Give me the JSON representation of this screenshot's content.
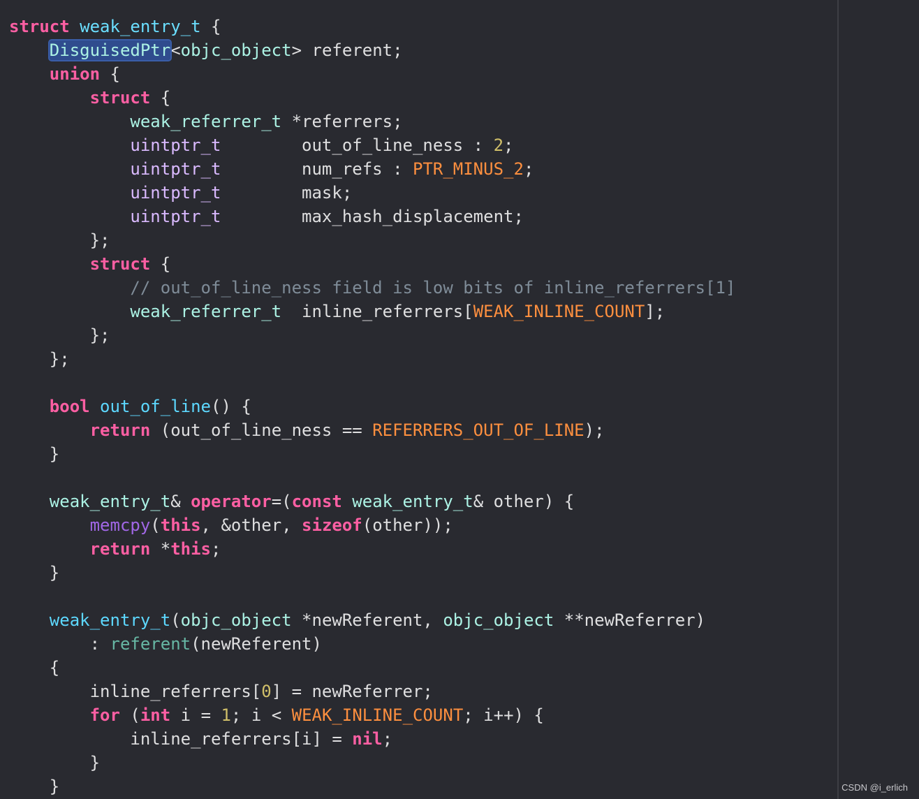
{
  "editor": {
    "theme_colors": {
      "background": "#292a30",
      "keyword": "#fc5fa3",
      "type": "#dabaff",
      "project_type": "#acf2e4",
      "declaration": "#6bdfff",
      "number": "#d0bf69",
      "macro": "#fd8f3f",
      "function": "#a167e6",
      "comment": "#7f8c98",
      "plain": "#dfdfe0",
      "selection": "#2f4c8e"
    },
    "lines": [
      [
        [
          "kw",
          "struct"
        ],
        [
          "pl",
          " "
        ],
        [
          "decl",
          "weak_entry_t"
        ],
        [
          "pl",
          " {"
        ]
      ],
      [
        [
          "pl",
          "    "
        ],
        [
          "ptype sel",
          "DisguisedPtr"
        ],
        [
          "pl",
          "<"
        ],
        [
          "ptype",
          "objc_object"
        ],
        [
          "pl",
          "> referent;"
        ]
      ],
      [
        [
          "pl",
          "    "
        ],
        [
          "kw",
          "union"
        ],
        [
          "pl",
          " {"
        ]
      ],
      [
        [
          "pl",
          "        "
        ],
        [
          "kw",
          "struct"
        ],
        [
          "pl",
          " {"
        ]
      ],
      [
        [
          "pl",
          "            "
        ],
        [
          "ptype",
          "weak_referrer_t"
        ],
        [
          "pl",
          " *referrers;"
        ]
      ],
      [
        [
          "pl",
          "            "
        ],
        [
          "type",
          "uintptr_t"
        ],
        [
          "pl",
          "        out_of_line_ness : "
        ],
        [
          "num",
          "2"
        ],
        [
          "pl",
          ";"
        ]
      ],
      [
        [
          "pl",
          "            "
        ],
        [
          "type",
          "uintptr_t"
        ],
        [
          "pl",
          "        num_refs : "
        ],
        [
          "macro",
          "PTR_MINUS_2"
        ],
        [
          "pl",
          ";"
        ]
      ],
      [
        [
          "pl",
          "            "
        ],
        [
          "type",
          "uintptr_t"
        ],
        [
          "pl",
          "        mask;"
        ]
      ],
      [
        [
          "pl",
          "            "
        ],
        [
          "type",
          "uintptr_t"
        ],
        [
          "pl",
          "        max_hash_displacement;"
        ]
      ],
      [
        [
          "pl",
          "        };"
        ]
      ],
      [
        [
          "pl",
          "        "
        ],
        [
          "kw",
          "struct"
        ],
        [
          "pl",
          " {"
        ]
      ],
      [
        [
          "pl",
          "            "
        ],
        [
          "cm",
          "// out_of_line_ness field is low bits of inline_referrers[1]"
        ]
      ],
      [
        [
          "pl",
          "            "
        ],
        [
          "ptype",
          "weak_referrer_t"
        ],
        [
          "pl",
          "  inline_referrers["
        ],
        [
          "macro",
          "WEAK_INLINE_COUNT"
        ],
        [
          "pl",
          "];"
        ]
      ],
      [
        [
          "pl",
          "        };"
        ]
      ],
      [
        [
          "pl",
          "    };"
        ]
      ],
      [
        [
          "pl",
          ""
        ]
      ],
      [
        [
          "pl",
          "    "
        ],
        [
          "kw",
          "bool"
        ],
        [
          "pl",
          " "
        ],
        [
          "decl2",
          "out_of_line"
        ],
        [
          "pl",
          "() {"
        ]
      ],
      [
        [
          "pl",
          "        "
        ],
        [
          "kw",
          "return"
        ],
        [
          "pl",
          " (out_of_line_ness == "
        ],
        [
          "macro",
          "REFERRERS_OUT_OF_LINE"
        ],
        [
          "pl",
          ");"
        ]
      ],
      [
        [
          "pl",
          "    }"
        ]
      ],
      [
        [
          "pl",
          ""
        ]
      ],
      [
        [
          "pl",
          "    "
        ],
        [
          "ptype",
          "weak_entry_t"
        ],
        [
          "pl",
          "& "
        ],
        [
          "kw",
          "operator"
        ],
        [
          "pl",
          "=("
        ],
        [
          "kw",
          "const"
        ],
        [
          "pl",
          " "
        ],
        [
          "ptype",
          "weak_entry_t"
        ],
        [
          "pl",
          "& other) {"
        ]
      ],
      [
        [
          "pl",
          "        "
        ],
        [
          "fn",
          "memcpy"
        ],
        [
          "pl",
          "("
        ],
        [
          "kw",
          "this"
        ],
        [
          "pl",
          ", &other, "
        ],
        [
          "kw",
          "sizeof"
        ],
        [
          "pl",
          "(other));"
        ]
      ],
      [
        [
          "pl",
          "        "
        ],
        [
          "kw",
          "return"
        ],
        [
          "pl",
          " *"
        ],
        [
          "kw",
          "this"
        ],
        [
          "pl",
          ";"
        ]
      ],
      [
        [
          "pl",
          "    }"
        ]
      ],
      [
        [
          "pl",
          ""
        ]
      ],
      [
        [
          "pl",
          "    "
        ],
        [
          "decl2",
          "weak_entry_t"
        ],
        [
          "pl",
          "("
        ],
        [
          "ptype",
          "objc_object"
        ],
        [
          "pl",
          " *newReferent, "
        ],
        [
          "ptype",
          "objc_object"
        ],
        [
          "pl",
          " **newReferrer)"
        ]
      ],
      [
        [
          "pl",
          "        : "
        ],
        [
          "proj",
          "referent"
        ],
        [
          "pl",
          "(newReferent)"
        ]
      ],
      [
        [
          "pl",
          "    {"
        ]
      ],
      [
        [
          "pl",
          "        inline_referrers["
        ],
        [
          "num",
          "0"
        ],
        [
          "pl",
          "] = newReferrer;"
        ]
      ],
      [
        [
          "pl",
          "        "
        ],
        [
          "kw",
          "for"
        ],
        [
          "pl",
          " ("
        ],
        [
          "kw",
          "int"
        ],
        [
          "pl",
          " i = "
        ],
        [
          "num",
          "1"
        ],
        [
          "pl",
          "; i < "
        ],
        [
          "macro",
          "WEAK_INLINE_COUNT"
        ],
        [
          "pl",
          "; i++) {"
        ]
      ],
      [
        [
          "pl",
          "            inline_referrers[i] = "
        ],
        [
          "kw",
          "nil"
        ],
        [
          "pl",
          ";"
        ]
      ],
      [
        [
          "pl",
          "        }"
        ]
      ],
      [
        [
          "pl",
          "    }"
        ]
      ]
    ]
  },
  "watermark": "CSDN @i_erlich"
}
